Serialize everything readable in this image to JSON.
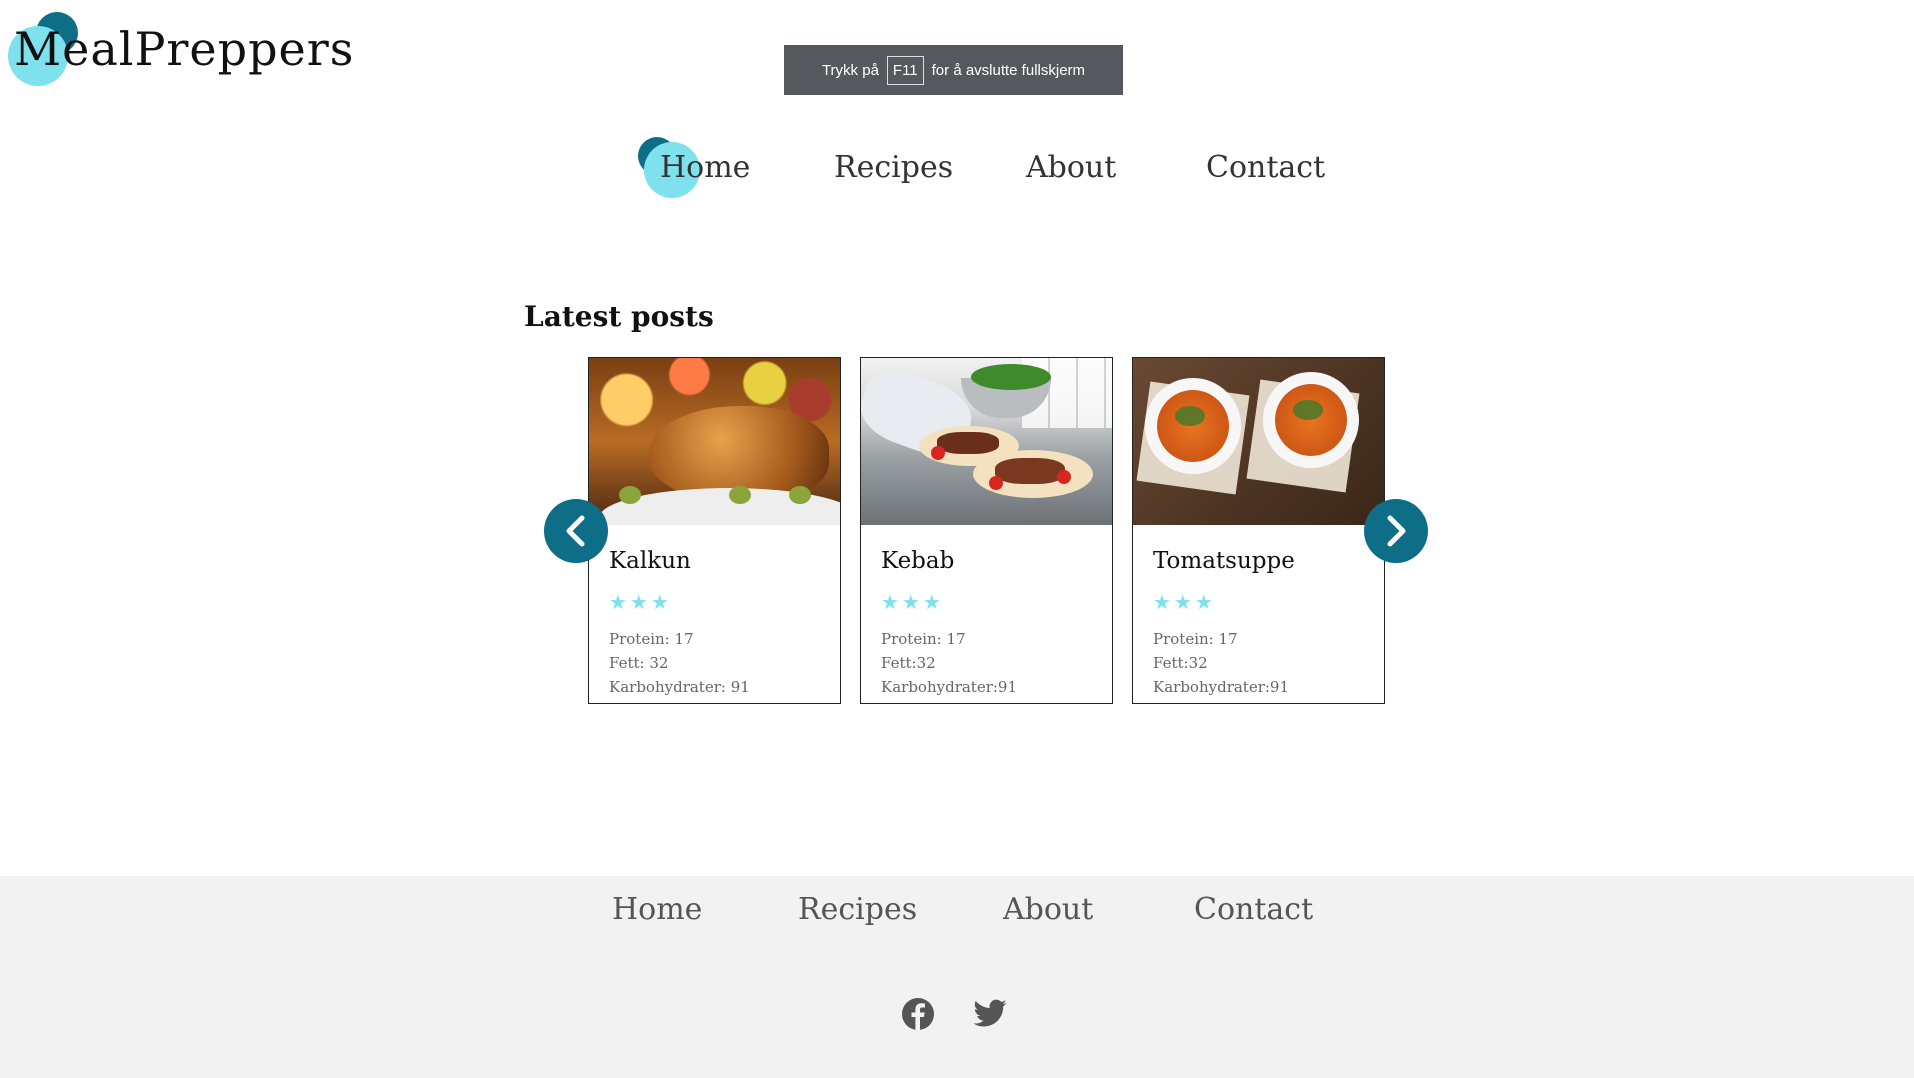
{
  "logo": {
    "text": "MealPreppers"
  },
  "fullscreen_notice": {
    "before": "Trykk på",
    "key": "F11",
    "after": "for å avslutte fullskjerm"
  },
  "nav": {
    "items": [
      {
        "label": "Home"
      },
      {
        "label": "Recipes"
      },
      {
        "label": "About"
      },
      {
        "label": "Contact"
      }
    ]
  },
  "latest": {
    "title": "Latest posts",
    "cards": [
      {
        "title": "Kalkun",
        "rating": 3,
        "stars": "★★★",
        "protein": "Protein: 17",
        "fat": "Fett: 32",
        "carbs": "Karbohydrater: 91",
        "image": "roast-turkey-photo"
      },
      {
        "title": "Kebab",
        "rating": 3,
        "stars": "★★★",
        "protein": "Protein: 17",
        "fat": "Fett:32",
        "carbs": "Karbohydrater:91",
        "image": "kebab-wraps-photo"
      },
      {
        "title": "Tomatsuppe",
        "rating": 3,
        "stars": "★★★",
        "protein": "Protein: 17",
        "fat": "Fett:32",
        "carbs": "Karbohydrater:91",
        "image": "tomato-soup-photo"
      }
    ]
  },
  "footer": {
    "links": [
      {
        "label": "Home"
      },
      {
        "label": "Recipes"
      },
      {
        "label": "About"
      },
      {
        "label": "Contact"
      }
    ],
    "social": [
      "facebook-icon",
      "twitter-icon"
    ]
  },
  "colors": {
    "accent_dark": "#0e6e87",
    "accent_light": "#7fe0ee",
    "footer_bg": "#f2f2f2"
  }
}
